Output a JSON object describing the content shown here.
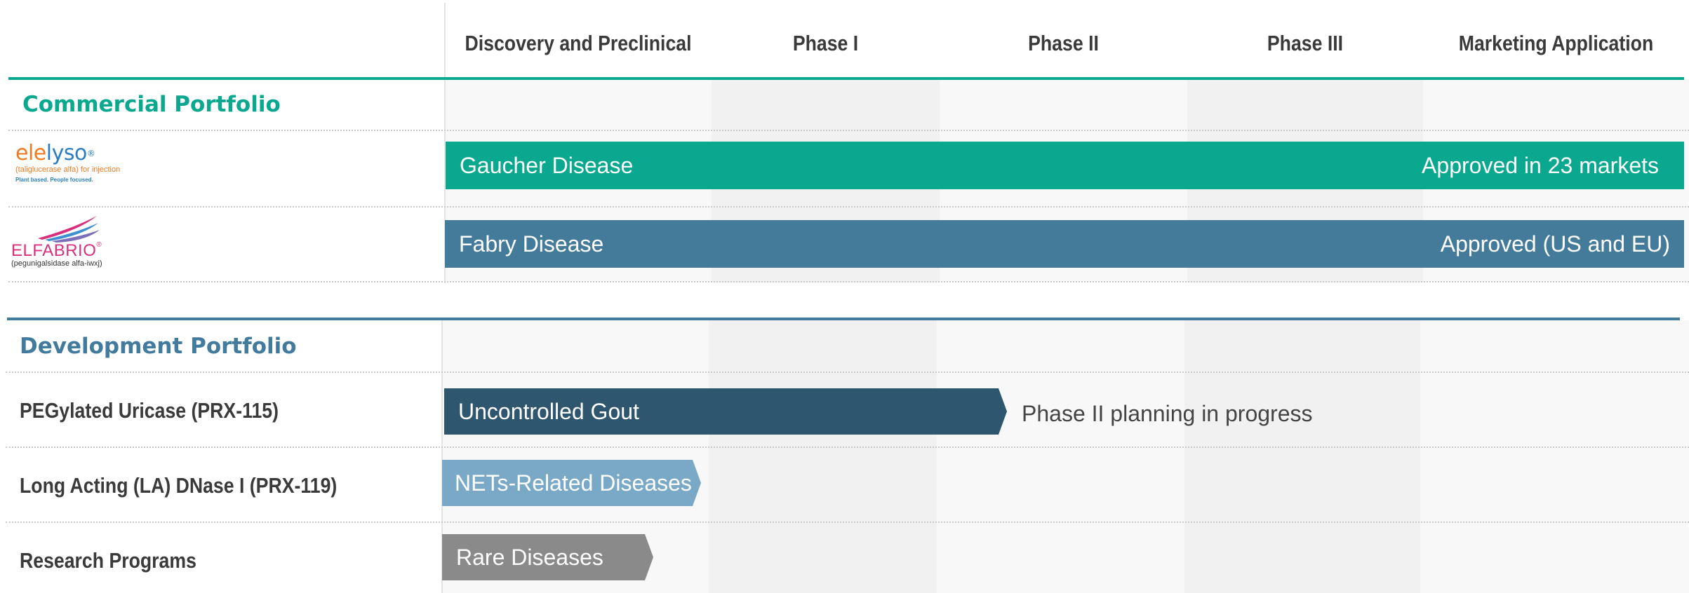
{
  "columns": [
    {
      "label": "Discovery and Preclinical"
    },
    {
      "label": "Phase I"
    },
    {
      "label": "Phase II"
    },
    {
      "label": "Phase III"
    },
    {
      "label": "Marketing Application"
    }
  ],
  "commercial": {
    "title": "Commercial Portfolio",
    "color": "#0aa88f",
    "rows": [
      {
        "logo_text_a": "ele",
        "logo_text_b": "lyso",
        "logo_reg": "®",
        "logo_sub": "(taliglucerase alfa) for injection",
        "logo_tag": "Plant based. People focused.",
        "bar_label": "Gaucher Disease",
        "status": "Approved in 23 markets",
        "bar_color": "#0aa88f",
        "progress": 1.0
      },
      {
        "logo_text": "ELFABRIO",
        "logo_reg": "®",
        "logo_sub": "(pegunigalsidase alfa-iwxj)",
        "bar_label": "Fabry Disease",
        "status": "Approved (US and EU)",
        "bar_color": "#457b9a",
        "progress": 1.0
      }
    ]
  },
  "development": {
    "title": "Development Portfolio",
    "color": "#427b9e",
    "rows": [
      {
        "name": "PEGylated Uricase (PRX-115)",
        "bar_label": "Uncontrolled Gout",
        "status": "Phase II planning in progress",
        "bar_color": "#2f566f",
        "progress_phase": "Phase I"
      },
      {
        "name": "Long Acting (LA) DNase I  (PRX-119)",
        "bar_label": "NETs-Related Diseases",
        "bar_color": "#79a9c6",
        "progress_phase": "Discovery and Preclinical"
      },
      {
        "name": "Research Programs",
        "bar_label": "Rare Diseases",
        "bar_color": "#8a8a8a",
        "progress_phase": "Discovery and Preclinical"
      }
    ]
  }
}
